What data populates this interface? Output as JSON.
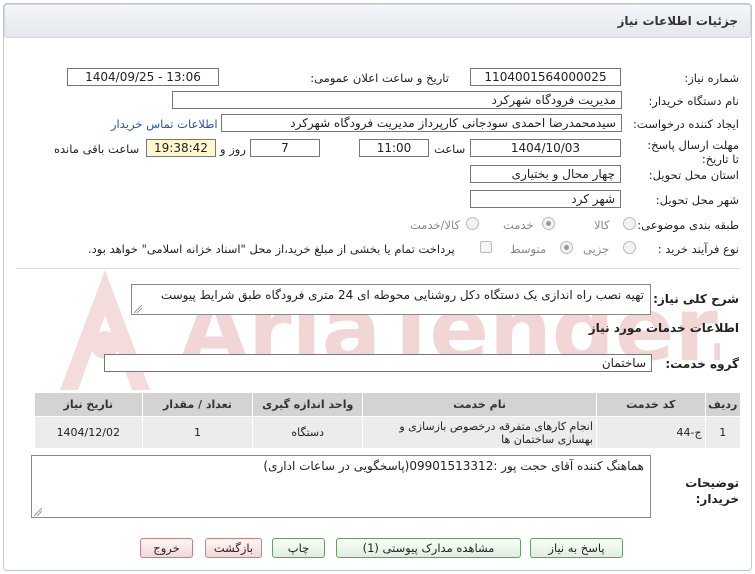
{
  "header": {
    "title": "جزئیات اطلاعات نیاز"
  },
  "form": {
    "need_number": {
      "label": "شماره نیاز:",
      "value": "1104001564000025"
    },
    "announce_datetime": {
      "label": "تاریخ و ساعت اعلان عمومی:",
      "value": "1404/09/25 - 13:06"
    },
    "buyer_org": {
      "label": "نام دستگاه خریدار:",
      "value": "مدیریت فرودگاه شهرکرد"
    },
    "requester": {
      "label": "ایجاد کننده درخواست:",
      "value": "سیدمحمدرضا احمدی سودجانی کارپرداز مدیریت فرودگاه شهرکرد"
    },
    "contact_link": "اطلاعات تماس خریدار",
    "deadline": {
      "label": "مهلت ارسال پاسخ: تا تاریخ:",
      "date": "1404/10/03",
      "time_label": "ساعت",
      "time": "11:00",
      "days": "7",
      "days_label": "روز و",
      "remaining": "19:38:42",
      "remaining_label": "ساعت باقی مانده"
    },
    "province": {
      "label": "استان محل تحویل:",
      "value": "چهار محال و بختیاری"
    },
    "city": {
      "label": "شهر محل تحویل:",
      "value": "شهر کرد"
    },
    "category": {
      "label": "طبقه بندی موضوعی:",
      "options": [
        "کالا",
        "خدمت",
        "کالا/خدمت"
      ],
      "selected": "خدمت"
    },
    "purchase_type": {
      "label": "نوع فرآیند خرید :",
      "options": [
        "جزیی",
        "متوسط"
      ],
      "selected": "متوسط",
      "payment_note": "پرداخت تمام یا بخشی از مبلغ خرید،از محل \"اسناد خزانه اسلامی\" خواهد بود."
    }
  },
  "description": {
    "label": "شرح کلی نیاز:",
    "value": "تهیه نصب راه اندازی یک دستگاه دکل روشنایی محوطه ای 24 متری فرودگاه طبق شرایط پیوست"
  },
  "services_section": {
    "title": "اطلاعات خدمات مورد نیاز",
    "group_label": "گروه خدمت:",
    "group_value": "ساختمان"
  },
  "table": {
    "headers": [
      "ردیف",
      "کد خدمت",
      "نام خدمت",
      "واحد اندازه گیری",
      "تعداد / مقدار",
      "تاریخ نیاز"
    ],
    "rows": [
      [
        "1",
        "ج-44",
        "انجام کارهای متفرقه درخصوص بازسازی و بهسازی ساختمان ها",
        "دستگاه",
        "1",
        "1404/12/02"
      ]
    ]
  },
  "buyer_notes": {
    "label": "توضیحات خریدار:",
    "value": "هماهنگ کننده آقای حجت پور :09901513312(پاسخگویی در ساعات اداری)"
  },
  "buttons": {
    "reply": "پاسخ به نیاز",
    "view_attachments": "مشاهده مدارک پیوستی (1)",
    "print": "چاپ",
    "back": "بازگشت",
    "exit": "خروج"
  },
  "watermark_text": "AriaTender.net",
  "colors": {
    "accent_link": "#1a55c8",
    "time_highlight": "#fff7cf",
    "watermark": "#f2d5d5"
  }
}
